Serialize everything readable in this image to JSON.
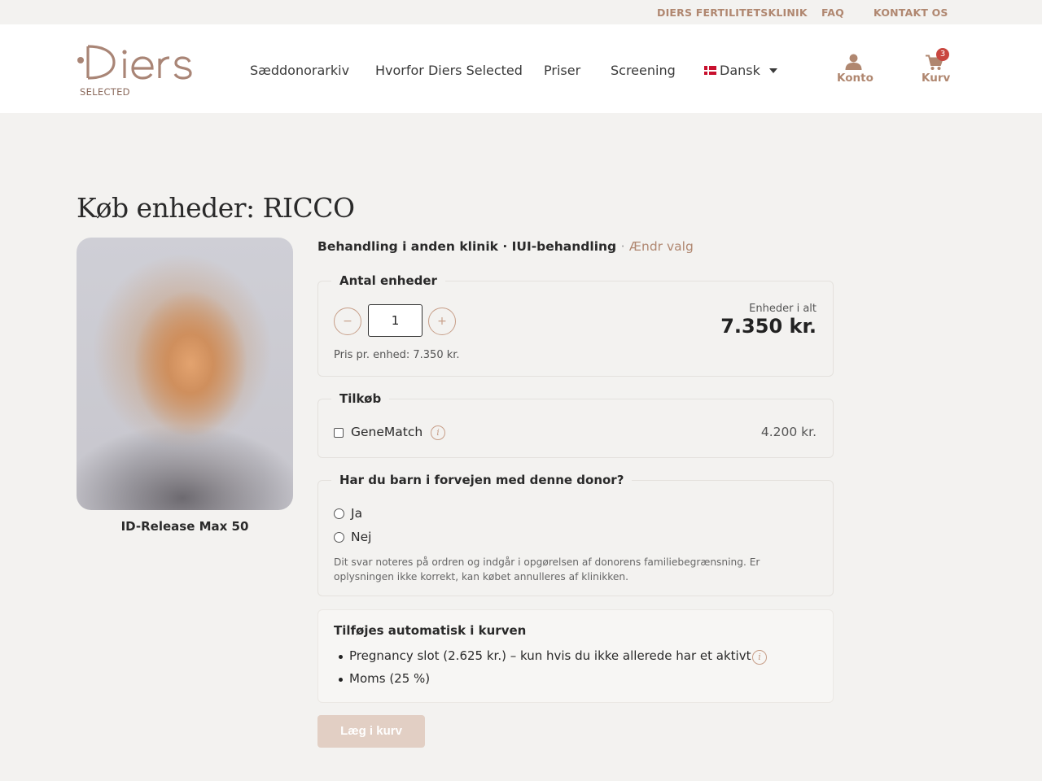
{
  "topbar": {
    "links": [
      "DIERS FERTILITETSKLINIK",
      "FAQ",
      "KONTAKT OS"
    ]
  },
  "header": {
    "logo_text": "Diers",
    "logo_sub": "SELECTED",
    "nav": [
      "Sæddonorarkiv",
      "Hvorfor Diers Selected",
      "Priser",
      "Screening"
    ],
    "language": "Dansk",
    "account_label": "Konto",
    "cart_label": "Kurv",
    "cart_count": "3"
  },
  "page": {
    "title": "Køb enheder: RICCO",
    "donor_caption": "ID-Release Max 50",
    "selection_text": "Behandling i anden klinik · IUI-behandling",
    "selection_separator": "·",
    "change_link": "Ændr valg"
  },
  "units": {
    "legend": "Antal enheder",
    "minus": "−",
    "plus": "+",
    "quantity": "1",
    "total_label": "Enheder i alt",
    "total_value": "7.350 kr.",
    "unit_price": "Pris pr. enhed: 7.350 kr."
  },
  "addons": {
    "legend": "Tilkøb",
    "item_label": "GeneMatch",
    "item_price": "4.200 kr.",
    "info_glyph": "i"
  },
  "children": {
    "legend": "Har du barn i forvejen med denne donor?",
    "options": [
      "Ja",
      "Nej"
    ],
    "note_line1": "Dit svar noteres på ordren og indgår i opgørelsen af donorens familiebegrænsning. Er",
    "note_line2": "oplysningen ikke korrekt, kan købet annulleres af klinikken."
  },
  "auto_added": {
    "title": "Tilføjes automatisk i kurven",
    "items": [
      "Pregnancy slot (2.625 kr.) – kun hvis du ikke allerede har et aktivt",
      "Moms (25 %)"
    ],
    "info_glyph": "i"
  },
  "cta": {
    "add_to_cart": "Læg i kurv"
  },
  "colors": {
    "accent": "#b08770",
    "background": "#f3f2f0",
    "badge": "#c9463f",
    "button_disabled": "#e2cfc4"
  }
}
